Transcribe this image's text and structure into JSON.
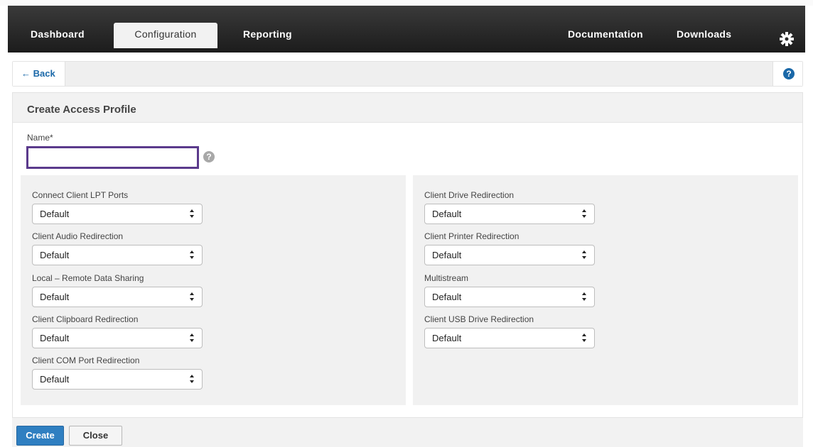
{
  "nav": {
    "dashboard": "Dashboard",
    "configuration": "Configuration",
    "reporting": "Reporting",
    "documentation": "Documentation",
    "downloads": "Downloads"
  },
  "backbar": {
    "back_label": "← Back",
    "help_glyph": "?"
  },
  "panel": {
    "title": "Create Access Profile"
  },
  "name_field": {
    "label": "Name*",
    "value": "",
    "help_glyph": "?"
  },
  "left_fields": [
    {
      "label": "Connect Client LPT Ports",
      "value": "Default"
    },
    {
      "label": "Client Audio Redirection",
      "value": "Default"
    },
    {
      "label": "Local – Remote Data Sharing",
      "value": "Default"
    },
    {
      "label": "Client Clipboard Redirection",
      "value": "Default"
    },
    {
      "label": "Client COM Port Redirection",
      "value": "Default"
    }
  ],
  "right_fields": [
    {
      "label": "Client Drive Redirection",
      "value": "Default"
    },
    {
      "label": "Client Printer Redirection",
      "value": "Default"
    },
    {
      "label": "Multistream",
      "value": "Default"
    },
    {
      "label": "Client USB Drive Redirection",
      "value": "Default"
    }
  ],
  "footer": {
    "create_label": "Create",
    "close_label": "Close"
  },
  "colors": {
    "nav_bg": "#2a2a2a",
    "accent_blue": "#2f7fc1",
    "input_focus": "#5b3a8c"
  },
  "icons": [
    "gear-icon",
    "back-arrow-icon",
    "help-icon",
    "field-help-icon",
    "select-arrows-icon"
  ]
}
